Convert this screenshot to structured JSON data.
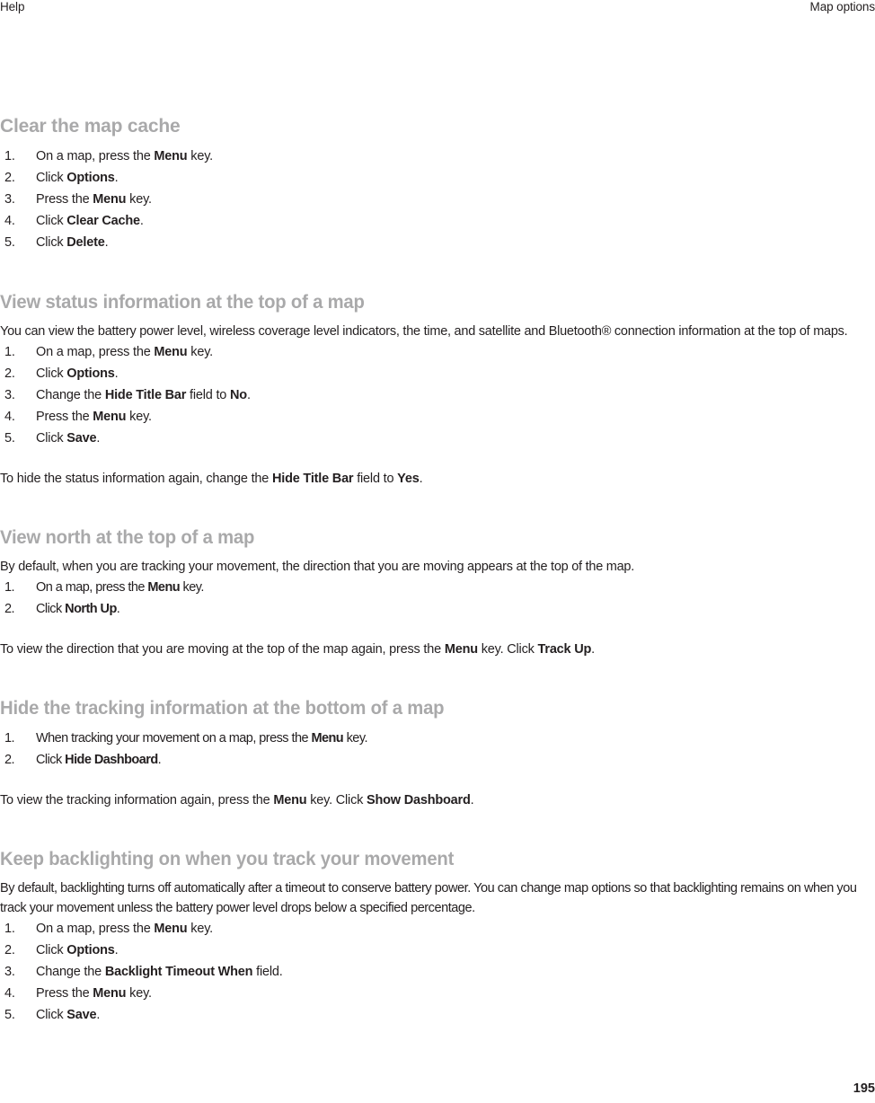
{
  "header": {
    "left": "Help",
    "right": "Map options"
  },
  "folio": {
    "page_number": "195"
  },
  "colors": {
    "heading": "#a9a9aa",
    "body": "#231f20",
    "background": "#ffffff"
  },
  "sections": [
    {
      "id": "clear-map-cache",
      "title": "Clear the map cache",
      "intro": null,
      "steps": [
        {
          "pre": "On a map, press the ",
          "bold": "Menu",
          "post": " key."
        },
        {
          "pre": "Click ",
          "bold": "Options",
          "post": "."
        },
        {
          "pre": "Press the ",
          "bold": "Menu",
          "post": " key."
        },
        {
          "pre": "Click ",
          "bold": "Clear Cache",
          "post": "."
        },
        {
          "pre": "Click ",
          "bold": "Delete",
          "post": "."
        }
      ],
      "note": null
    },
    {
      "id": "view-status-information",
      "title": "View status information at the top of a map",
      "intro": "You can view the battery power level, wireless coverage level indicators, the time, and satellite and Bluetooth® connection information at the top of maps.",
      "steps": [
        {
          "pre": "On a map, press the ",
          "bold": "Menu",
          "post": " key."
        },
        {
          "pre": "Click ",
          "bold": "Options",
          "post": "."
        },
        {
          "pre": "Change the ",
          "bold": "Hide Title Bar",
          "post": " field to ",
          "bold2": "No",
          "post2": "."
        },
        {
          "pre": "Press the ",
          "bold": "Menu",
          "post": " key."
        },
        {
          "pre": "Click ",
          "bold": "Save",
          "post": "."
        }
      ],
      "note": {
        "pre": "To hide the status information again, change the ",
        "bold": "Hide Title Bar",
        "post": " field to ",
        "bold2": "Yes",
        "post2": "."
      }
    },
    {
      "id": "view-north-at-top",
      "title": "View north at the top of a map",
      "intro": "By default, when you are tracking your movement, the direction that you are moving appears at the top of the map.",
      "steps": [
        {
          "pre": "On a map, press the ",
          "bold": "Menu",
          "post": " key."
        },
        {
          "pre": "Click ",
          "bold": "North Up",
          "post": "."
        }
      ],
      "note": {
        "pre": "To view the direction that you are moving at the top of the map again, press the ",
        "bold": "Menu",
        "post": " key. Click ",
        "bold2": "Track Up",
        "post2": "."
      }
    },
    {
      "id": "hide-tracking-information",
      "title": "Hide the tracking information at the bottom of a map",
      "intro": null,
      "steps": [
        {
          "pre": "When tracking your movement on a map, press the ",
          "bold": "Menu",
          "post": " key."
        },
        {
          "pre": "Click ",
          "bold": "Hide Dashboard",
          "post": "."
        }
      ],
      "note": {
        "pre": "To view the tracking information again, press the ",
        "bold": "Menu",
        "post": " key. Click ",
        "bold2": "Show Dashboard",
        "post2": "."
      }
    },
    {
      "id": "keep-backlighting-on",
      "title": "Keep backlighting on when you track your movement",
      "intro": "By default, backlighting turns off automatically after a timeout to conserve battery power. You can change map options so that backlighting remains on when you track your movement unless the battery power level drops below a specified percentage.",
      "steps": [
        {
          "pre": "On a map, press the ",
          "bold": "Menu",
          "post": " key."
        },
        {
          "pre": "Click ",
          "bold": "Options",
          "post": "."
        },
        {
          "pre": "Change the ",
          "bold": "Backlight Timeout When",
          "post": " field."
        },
        {
          "pre": "Press the ",
          "bold": "Menu",
          "post": " key."
        },
        {
          "pre": "Click ",
          "bold": "Save",
          "post": "."
        }
      ],
      "note": null
    }
  ]
}
